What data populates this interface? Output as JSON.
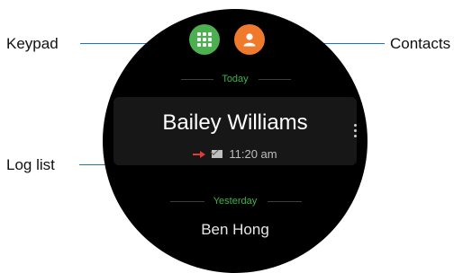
{
  "callouts": {
    "keypad": "Keypad",
    "contacts": "Contacts",
    "log_list": "Log list"
  },
  "watch": {
    "buttons": [
      {
        "name": "keypad",
        "icon": "keypad-icon",
        "color": "#4caf50"
      },
      {
        "name": "contacts",
        "icon": "person-icon",
        "color": "#f07a2c"
      }
    ],
    "sections": [
      {
        "header": "Today",
        "entries": [
          {
            "name": "Bailey Williams",
            "direction_icon": "outgoing-arrow-icon",
            "type_icon": "message-icon",
            "time": "11:20 am"
          }
        ]
      },
      {
        "header": "Yesterday",
        "entries": [
          {
            "name": "Ben Hong"
          }
        ]
      }
    ],
    "colors": {
      "section_header": "#39b54a",
      "callout_line": "#1b75bb",
      "outgoing_arrow": "#e53935"
    }
  }
}
